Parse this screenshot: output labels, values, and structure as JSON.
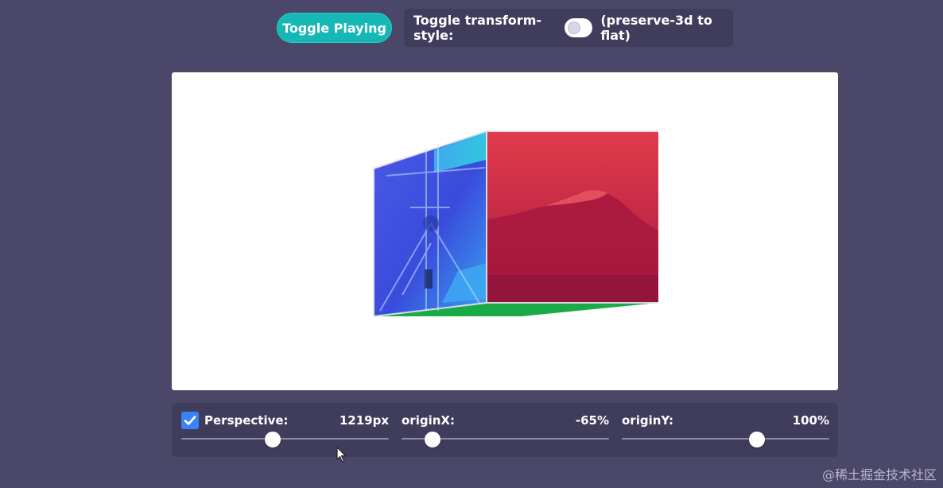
{
  "top_bar": {
    "toggle_playing_label": "Toggle Playing",
    "transform_style_label": "Toggle transform-style:",
    "transform_style_note": "(preserve-3d to flat)",
    "switch_on": false
  },
  "controls": {
    "perspective": {
      "checked": true,
      "label": "Perspective:",
      "value": "1219px",
      "fraction": 0.44
    },
    "origin_x": {
      "label": "originX:",
      "value": "-65%",
      "fraction": 0.15
    },
    "origin_y": {
      "label": "originY:",
      "value": "100%",
      "fraction": 0.65
    }
  },
  "colors": {
    "background": "#4a4769",
    "panel": "#403d5c",
    "accent_button": "#16b8b5",
    "checkbox": "#3b82f6",
    "face_front": "#de3b4a",
    "face_left": "#3a4bdc",
    "face_left_light": "#3ea8f2",
    "face_bottom": "#1aaa48"
  },
  "icons": {
    "checkbox": "check-icon",
    "cursor": "mouse-pointer-icon"
  },
  "watermark": "@稀土掘金技术社区"
}
